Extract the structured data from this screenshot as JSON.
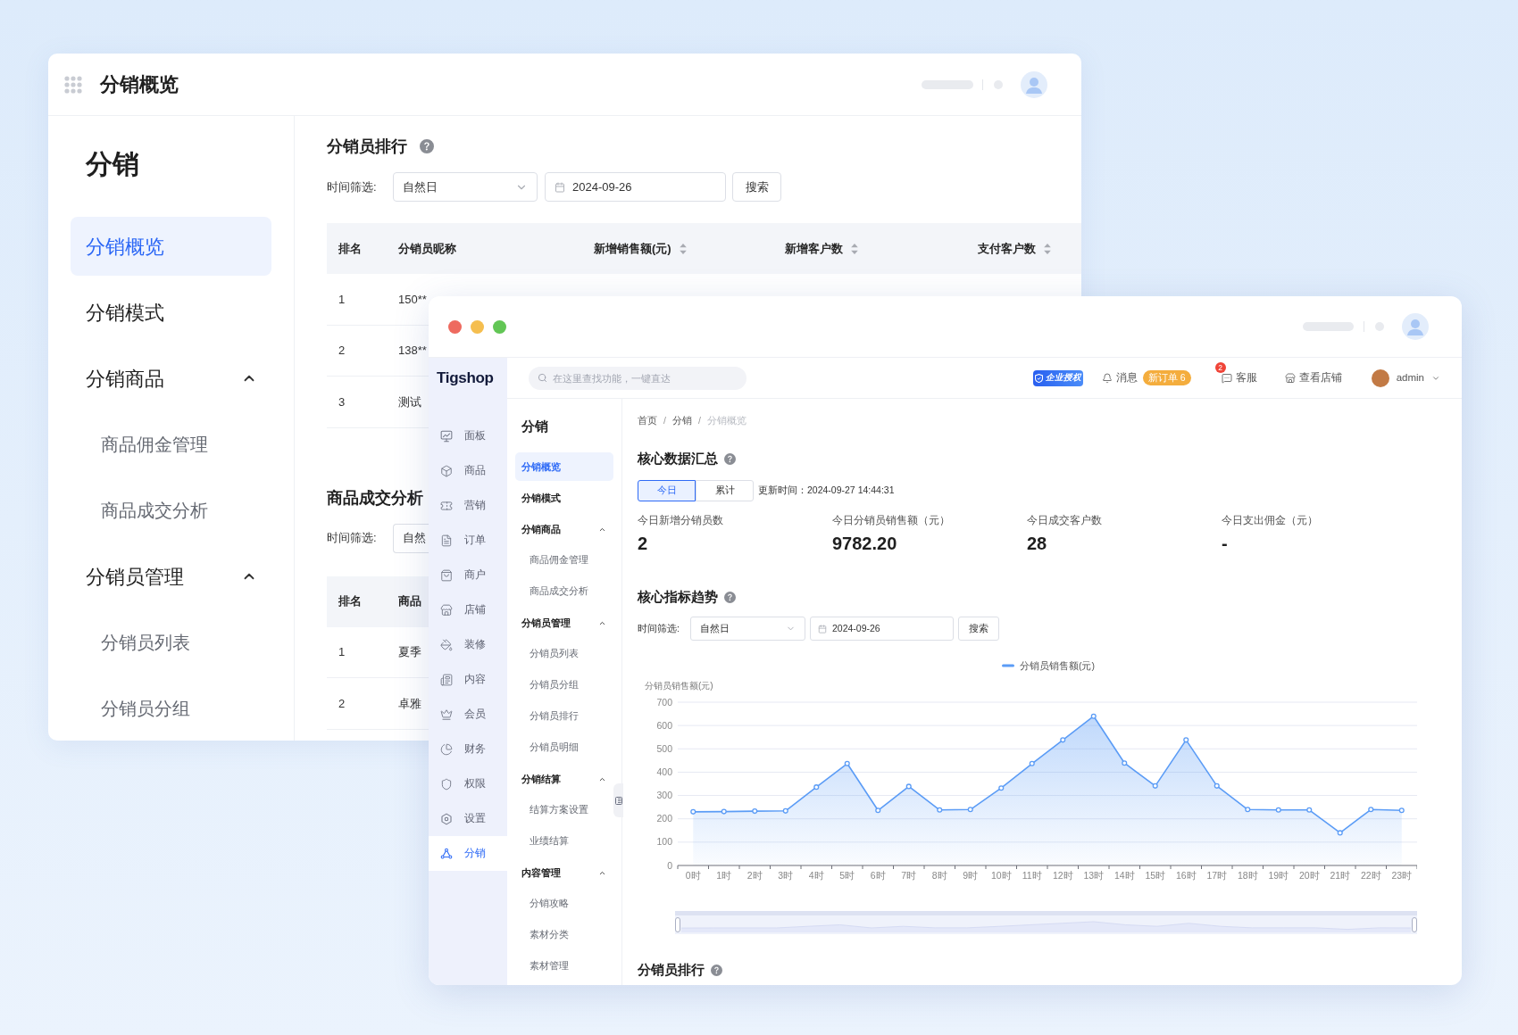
{
  "back_window": {
    "title": "分销概览",
    "sidebar": {
      "title": "分销",
      "items": [
        {
          "label": "分销概览",
          "selected": true
        },
        {
          "label": "分销模式",
          "selected": false
        },
        {
          "label": "分销商品",
          "selected": false,
          "expanded": true,
          "children": [
            {
              "label": "商品佣金管理",
              "selected": false
            },
            {
              "label": "商品成交分析",
              "selected": false
            }
          ]
        },
        {
          "label": "分销员管理",
          "selected": false,
          "expanded": true,
          "children": [
            {
              "label": "分销员列表",
              "selected": false
            },
            {
              "label": "分销员分组",
              "selected": false
            }
          ]
        }
      ]
    },
    "ranking": {
      "title": "分销员排行",
      "filter": {
        "label": "时间筛选:",
        "select_value": "自然日",
        "date": "2024-09-26",
        "button": "搜索"
      },
      "table": {
        "columns": [
          {
            "label": "排名",
            "sortable": false
          },
          {
            "label": "分销员昵称",
            "sortable": false
          },
          {
            "label": "新增销售额(元)",
            "sortable": true
          },
          {
            "label": "新增客户数",
            "sortable": true
          },
          {
            "label": "支付客户数",
            "sortable": true
          }
        ],
        "rows": [
          [
            "1",
            "150**"
          ],
          [
            "2",
            "138**"
          ],
          [
            "3",
            "测试"
          ]
        ]
      }
    },
    "product_analysis": {
      "title": "商品成交分析",
      "filter": {
        "label": "时间筛选:",
        "select_value": "自然"
      },
      "table": {
        "columns": [
          {
            "label": "排名",
            "sortable": false
          },
          {
            "label": "商品",
            "sortable": false
          }
        ],
        "rows": [
          [
            "1",
            "夏季"
          ],
          [
            "2",
            "卓雅"
          ]
        ]
      }
    }
  },
  "front_window": {
    "logo": "Tigshop",
    "search": {
      "placeholder": "在这里查找功能，一键直达"
    },
    "license_badge": "企业授权",
    "messages": {
      "label": "消息",
      "badge": "新订单 6"
    },
    "support": {
      "label": "客服",
      "count": "2"
    },
    "view_store": "查看店铺",
    "user": "admin",
    "nav": [
      {
        "label": "面板",
        "selected": false
      },
      {
        "label": "商品",
        "selected": false
      },
      {
        "label": "营销",
        "selected": false
      },
      {
        "label": "订单",
        "selected": false
      },
      {
        "label": "商户",
        "selected": false
      },
      {
        "label": "店铺",
        "selected": false
      },
      {
        "label": "装修",
        "selected": false
      },
      {
        "label": "内容",
        "selected": false
      },
      {
        "label": "会员",
        "selected": false
      },
      {
        "label": "财务",
        "selected": false
      },
      {
        "label": "权限",
        "selected": false
      },
      {
        "label": "设置",
        "selected": false
      },
      {
        "label": "分销",
        "selected": true
      }
    ],
    "subnav": {
      "title": "分销",
      "items": [
        {
          "label": "分销概览",
          "selected": true
        },
        {
          "label": "分销模式",
          "selected": false
        },
        {
          "label": "分销商品",
          "selected": false,
          "expanded": true,
          "children": [
            {
              "label": "商品佣金管理",
              "selected": false
            },
            {
              "label": "商品成交分析",
              "selected": false
            }
          ]
        },
        {
          "label": "分销员管理",
          "selected": false,
          "expanded": true,
          "children": [
            {
              "label": "分销员列表",
              "selected": false
            },
            {
              "label": "分销员分组",
              "selected": false
            },
            {
              "label": "分销员排行",
              "selected": false
            },
            {
              "label": "分销员明细",
              "selected": false
            }
          ]
        },
        {
          "label": "分销结算",
          "selected": false,
          "expanded": true,
          "children": [
            {
              "label": "结算方案设置",
              "selected": false
            },
            {
              "label": "业绩结算",
              "selected": false
            }
          ]
        },
        {
          "label": "内容管理",
          "selected": false,
          "expanded": true,
          "children": [
            {
              "label": "分销攻略",
              "selected": false
            },
            {
              "label": "素材分类",
              "selected": false
            },
            {
              "label": "素材管理",
              "selected": false
            }
          ]
        }
      ]
    },
    "breadcrumb": {
      "items": [
        {
          "label": "首页",
          "current": false
        },
        {
          "label": "分销",
          "current": false
        },
        {
          "label": "分销概览",
          "current": true
        }
      ],
      "separators": [
        "/",
        "/"
      ]
    },
    "summary": {
      "title": "核心数据汇总",
      "tabs": [
        {
          "label": "今日",
          "selected": true
        },
        {
          "label": "累计",
          "selected": false
        }
      ],
      "updated": "更新时间：2024-09-27 14:44:31",
      "stats": [
        {
          "label": "今日新增分销员数",
          "value": "2"
        },
        {
          "label": "今日分销员销售额（元）",
          "value": "9782.20"
        },
        {
          "label": "今日成交客户数",
          "value": "28"
        },
        {
          "label": "今日支出佣金（元）",
          "value": "-"
        }
      ]
    },
    "trend": {
      "title": "核心指标趋势",
      "filter": {
        "label": "时间筛选:",
        "select_value": "自然日",
        "date": "2024-09-26",
        "button": "搜索"
      },
      "chart_data": {
        "type": "area",
        "ylabel": "分销员销售额(元)",
        "categories": [
          "0时",
          "1时",
          "2时",
          "3时",
          "4时",
          "5时",
          "6时",
          "7时",
          "8时",
          "9时",
          "10时",
          "11时",
          "12时",
          "13时",
          "14时",
          "15时",
          "16时",
          "17时",
          "18时",
          "19时",
          "20时",
          "21时",
          "22时",
          "23时"
        ],
        "series": [
          {
            "name": "分销员销售额(元)",
            "color": "#5b9cf6",
            "values": [
              230,
              231,
              233,
              234,
              336,
              437,
              236,
              339,
              238,
              240,
              332,
              437,
              538,
              640,
              439,
              341,
              538,
              341,
              240,
              238,
              238,
              140,
              240,
              236
            ]
          }
        ],
        "ylim": [
          0,
          700
        ],
        "yticks": [
          0,
          100,
          200,
          300,
          400,
          500,
          600,
          700
        ],
        "grid": true
      },
      "zoom_slider": {
        "level": 1
      }
    },
    "ranking": {
      "title": "分销员排行"
    }
  }
}
